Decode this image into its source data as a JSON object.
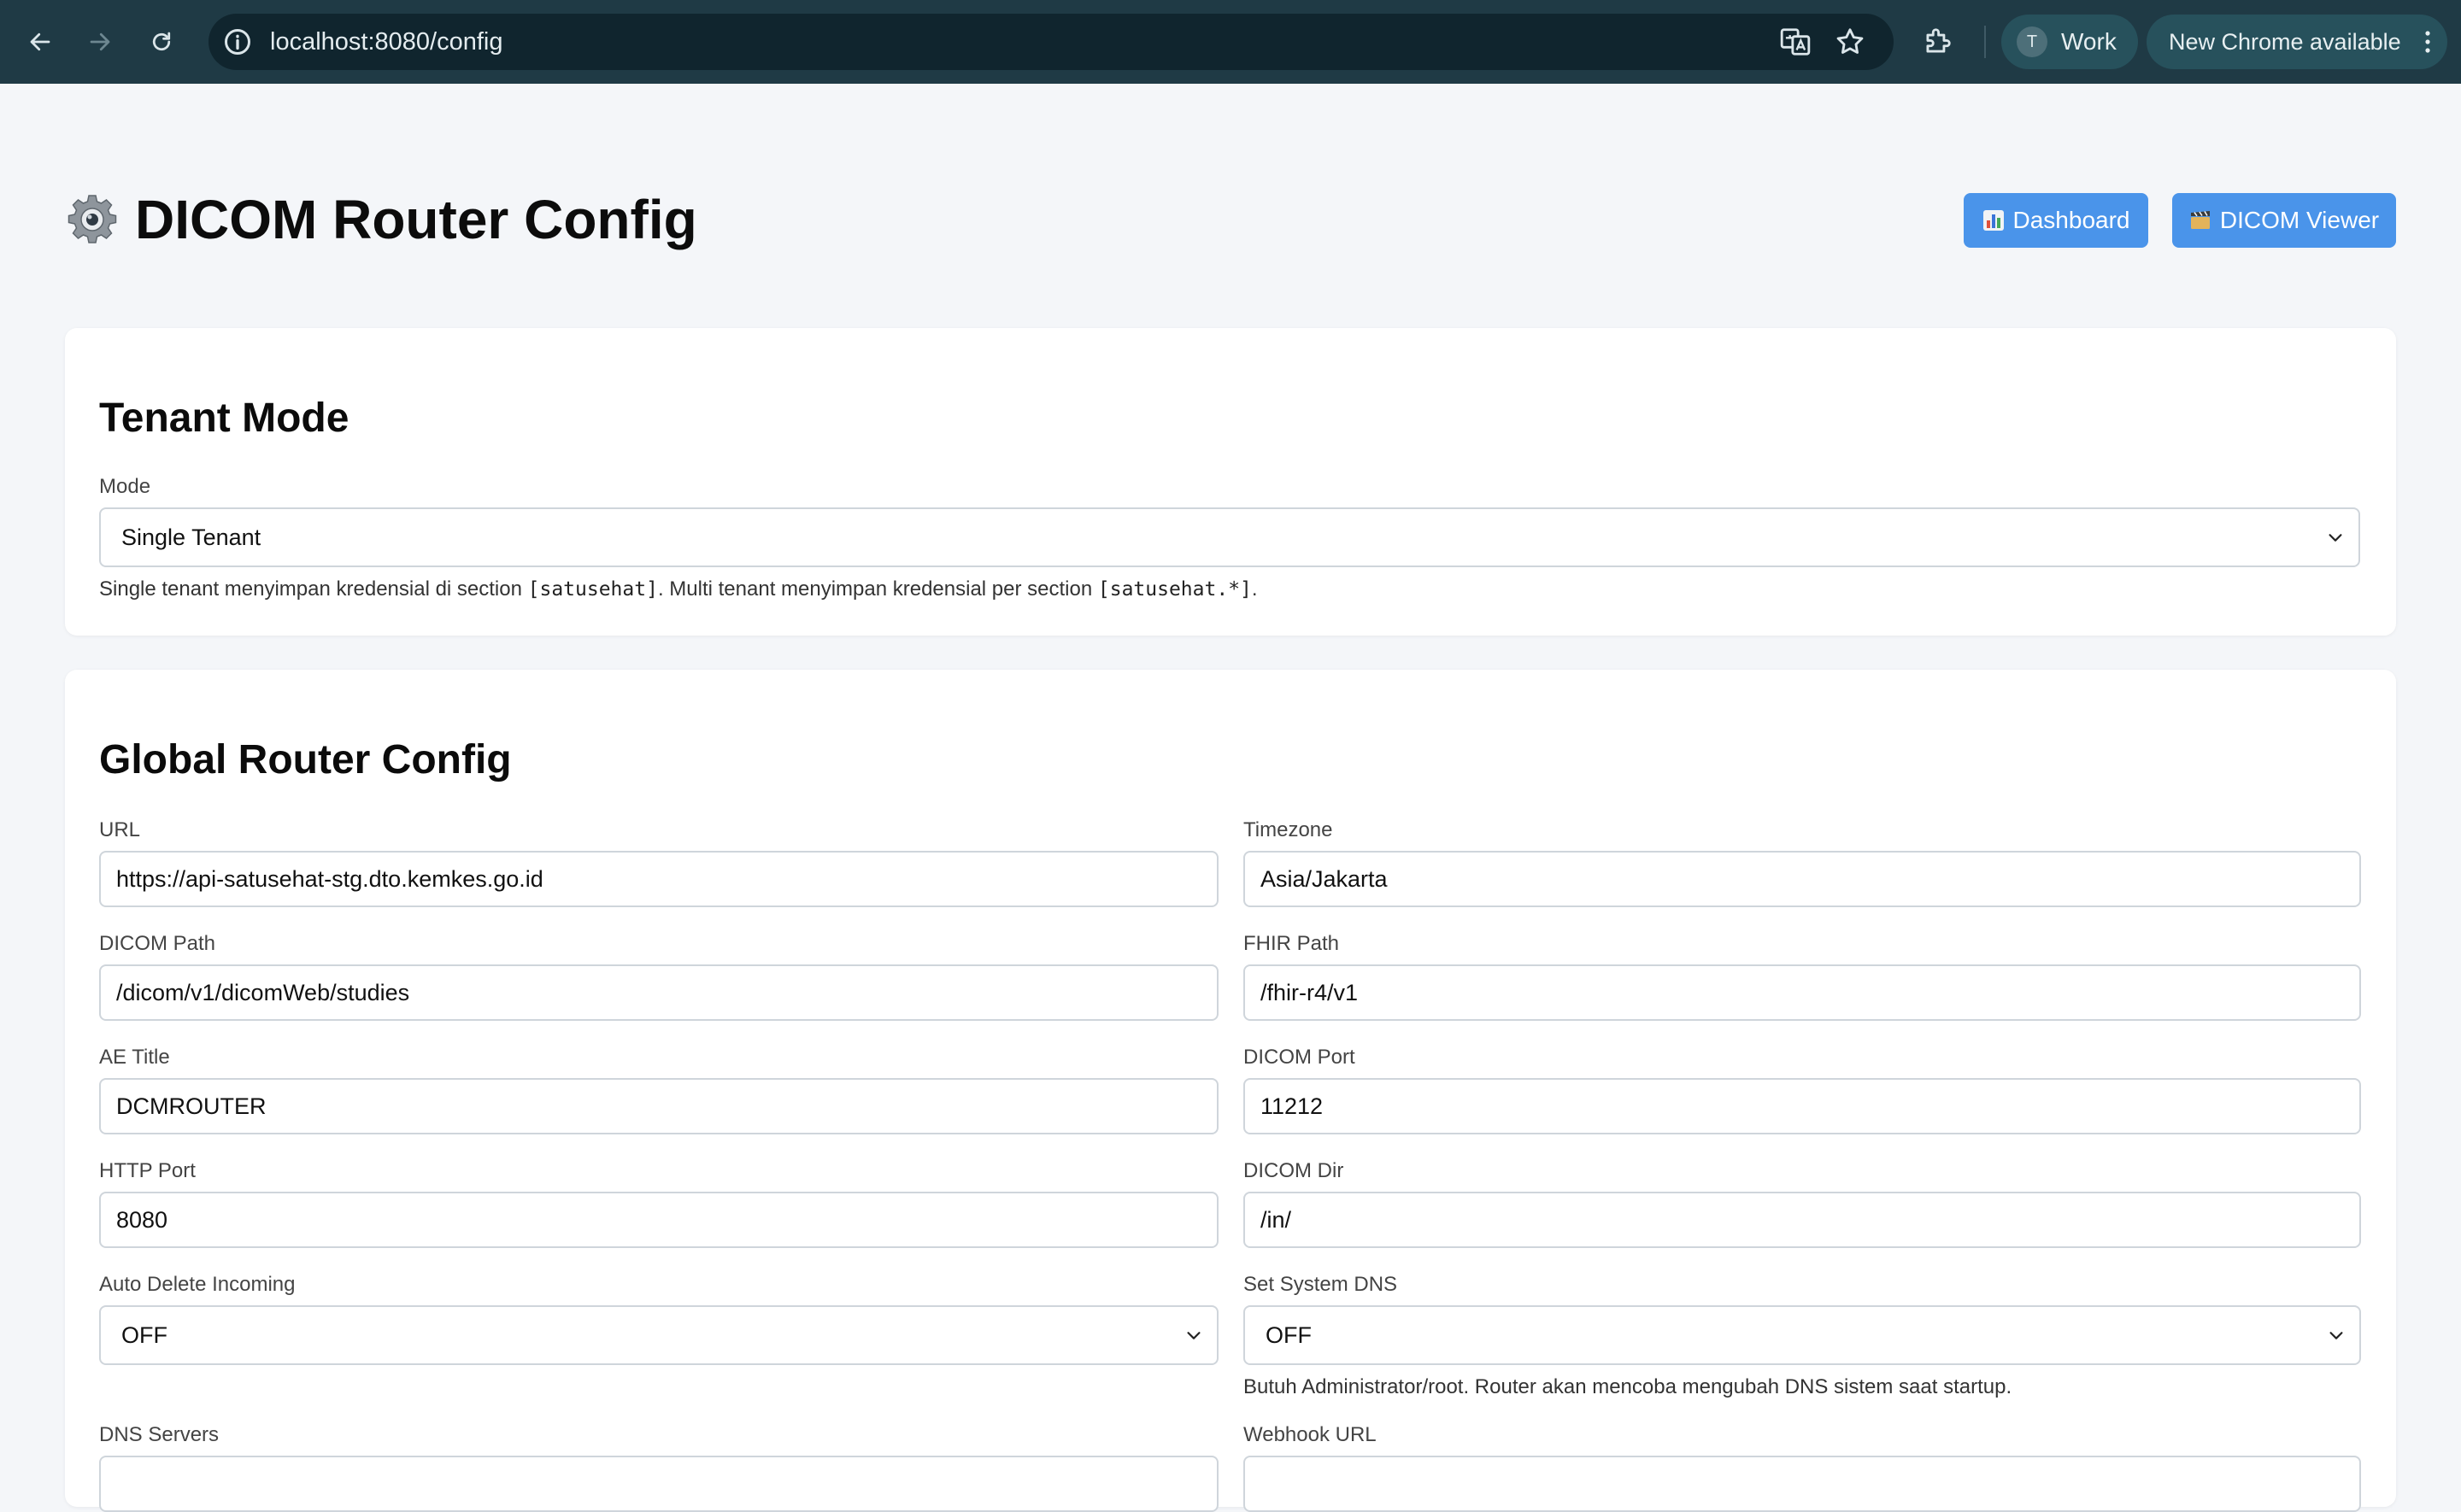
{
  "browser": {
    "url": "localhost:8080/config",
    "profile_initial": "T",
    "profile_name": "Work",
    "update_label": "New Chrome available"
  },
  "header": {
    "title": "DICOM Router Config",
    "dashboard_label": "Dashboard",
    "viewer_label": "DICOM Viewer"
  },
  "tenant": {
    "heading": "Tenant Mode",
    "mode_label": "Mode",
    "mode_value": "Single Tenant",
    "help_pre": "Single tenant menyimpan kredensial di section ",
    "help_code1": "[satusehat]",
    "help_mid": ". Multi tenant menyimpan kredensial per section ",
    "help_code2": "[satusehat.*]",
    "help_post": "."
  },
  "global": {
    "heading": "Global Router Config",
    "url_label": "URL",
    "url_value": "https://api-satusehat-stg.dto.kemkes.go.id",
    "timezone_label": "Timezone",
    "timezone_value": "Asia/Jakarta",
    "dicom_path_label": "DICOM Path",
    "dicom_path_value": "/dicom/v1/dicomWeb/studies",
    "fhir_path_label": "FHIR Path",
    "fhir_path_value": "/fhir-r4/v1",
    "ae_title_label": "AE Title",
    "ae_title_value": "DCMROUTER",
    "dicom_port_label": "DICOM Port",
    "dicom_port_value": "11212",
    "http_port_label": "HTTP Port",
    "http_port_value": "8080",
    "dicom_dir_label": "DICOM Dir",
    "dicom_dir_value": "/in/",
    "auto_delete_label": "Auto Delete Incoming",
    "auto_delete_value": "OFF",
    "system_dns_label": "Set System DNS",
    "system_dns_value": "OFF",
    "system_dns_help": "Butuh Administrator/root. Router akan mencoba mengubah DNS sistem saat startup.",
    "dns_servers_label": "DNS Servers",
    "webhook_url_label": "Webhook URL"
  }
}
